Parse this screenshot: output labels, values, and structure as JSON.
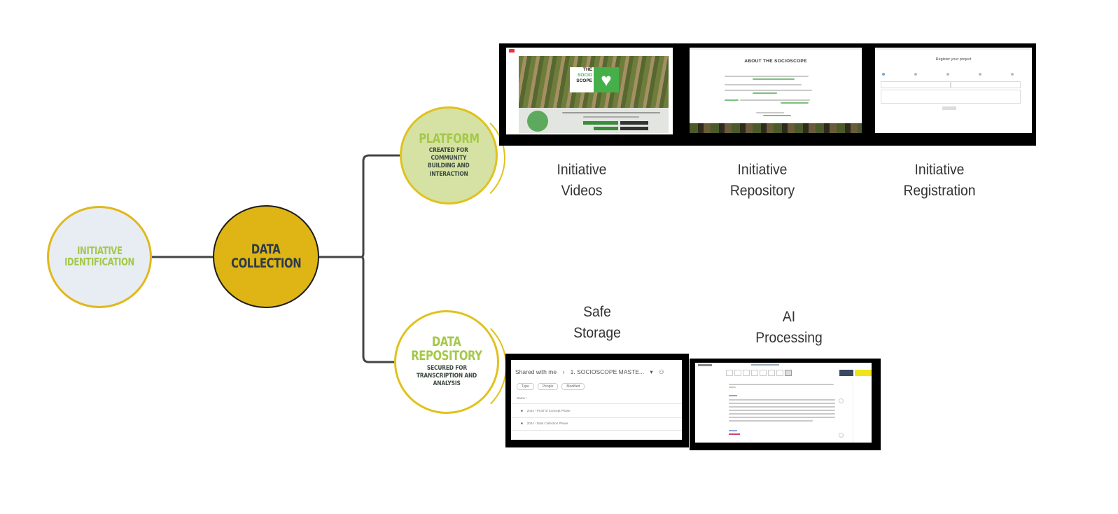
{
  "diagram": {
    "type": "mind-map / process flow",
    "colors": {
      "accent_gold": "#deb515",
      "ring_gold": "#e0c21e",
      "title_green": "#a5c84a",
      "platform_fill": "#d6e2a4",
      "ident_fill": "#e8edf4",
      "connector": "#444444",
      "dark_text": "#2c3a4b"
    },
    "nodes": {
      "identification": {
        "title_line1": "INITIATIVE",
        "title_line2": "IDENTIFICATION"
      },
      "collection": {
        "title_line1": "DATA",
        "title_line2": "COLLECTION"
      },
      "platform": {
        "title": "PLATFORM",
        "sub_line1": "CREATED FOR",
        "sub_line2": "COMMUNITY",
        "sub_line3": "BUILDING AND",
        "sub_line4": "INTERACTION"
      },
      "repository": {
        "title_line1": "DATA",
        "title_line2": "REPOSITORY",
        "sub_line1": "SECURED FOR",
        "sub_line2": "TRANSCRIPTION AND",
        "sub_line3": "ANALYSIS"
      }
    },
    "platform_items": [
      {
        "line1": "Initiative",
        "line2": "Videos"
      },
      {
        "line1": "Initiative",
        "line2": "Repository"
      },
      {
        "line1": "Initiative",
        "line2": "Registration"
      }
    ],
    "repository_items": [
      {
        "line1": "Safe",
        "line2": "Storage"
      },
      {
        "line1": "AI",
        "line2": "Processing"
      }
    ],
    "screenshots": {
      "videos": {
        "brand_line1": "THE",
        "brand_line2": "SOCIO",
        "brand_line3": "SCOPE"
      },
      "about": {
        "heading": "ABOUT THE SOCIOSCOPE"
      },
      "register": {
        "heading": "Register your project"
      },
      "storage": {
        "breadcrumb_root": "Shared with me",
        "breadcrumb_sep": "›",
        "breadcrumb_folder": "1. SOCIOSCOPE MASTE...",
        "filters": [
          "Type",
          "People",
          "Modified"
        ],
        "column_header": "Name",
        "rows": [
          "2024 - Proof of Concept Phase",
          "2024 - Data Collection Phase"
        ]
      }
    }
  }
}
